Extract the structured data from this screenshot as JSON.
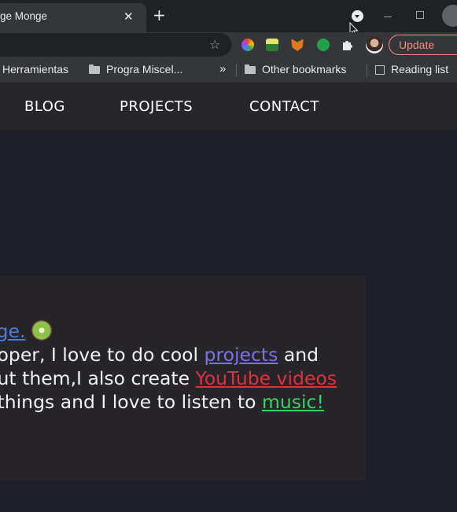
{
  "browser": {
    "tab_title": "ge Monge",
    "tab_close": "✕",
    "new_tab": "+",
    "update_label": "Update",
    "bookmarks": [
      {
        "label": "Herramientas"
      },
      {
        "label": "Progra Miscel..."
      },
      {
        "label": "Other bookmarks"
      },
      {
        "label": "Reading list"
      }
    ],
    "overflow": "»"
  },
  "site": {
    "nav": [
      "BLOG",
      "PROJECTS",
      "CONTACT"
    ],
    "intro": {
      "line1_link": "ge.",
      "line2_text": "oper, I love to do cool ",
      "line2_link": "projects",
      "line2_tail": " and",
      "line3_text": "ut them,I also create ",
      "line3_link": "YouTube videos",
      "line4_text": "things and I love to listen to ",
      "line4_link": "music!"
    }
  },
  "colors": {
    "page_bg": "#1e2029",
    "card_bg": "#27242a",
    "link_blue": "#4a7fd9",
    "link_purple": "#7a73e6",
    "link_red": "#e0303a",
    "link_green": "#3ad167",
    "update_accent": "#f28b82"
  },
  "icons": [
    "tab-search-icon",
    "star-icon",
    "puzzle-icon",
    "kiwi-emoji-icon",
    "folder-icon",
    "reading-list-icon"
  ]
}
